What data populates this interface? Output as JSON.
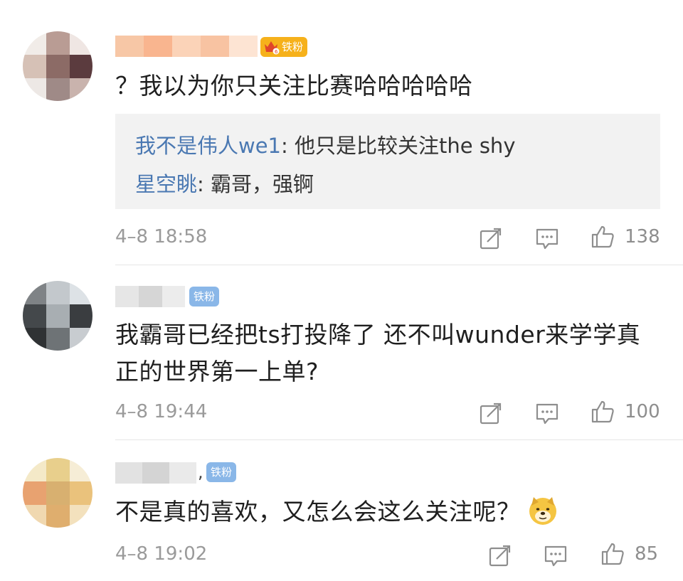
{
  "comments": [
    {
      "badge": "铁粉",
      "text": "？我以为你只关注比赛哈哈哈哈哈",
      "replies": [
        {
          "user": "我不是伟人we1",
          "sep": ": ",
          "text": "他只是比较关注the shy"
        },
        {
          "user": "星空眺",
          "sep": ": ",
          "text": "霸哥，强锕"
        }
      ],
      "time": "4–8 18:58",
      "likes": "138"
    },
    {
      "badge": "铁粉",
      "text_line1": "我霸哥已经把ts打投降了 还不叫wunder来学学真",
      "text_line2": "正的世界第一上单?",
      "time": "4–8 19:44",
      "likes": "100"
    },
    {
      "badge": "铁粉",
      "name_tail": ",",
      "text": "不是真的喜欢，又怎么会这么关注呢？",
      "emoji": "doge-emoji",
      "time": "4–8 19:02",
      "likes": "85"
    }
  ],
  "icons": {
    "share": "share-icon",
    "reply": "reply-icon",
    "like": "thumbs-up-icon"
  },
  "colors": {
    "link_blue": "#4a78b2",
    "gold_badge": "#f6b11b",
    "blue_badge": "#8ab7e8",
    "meta_gray": "#9a9a9a"
  }
}
